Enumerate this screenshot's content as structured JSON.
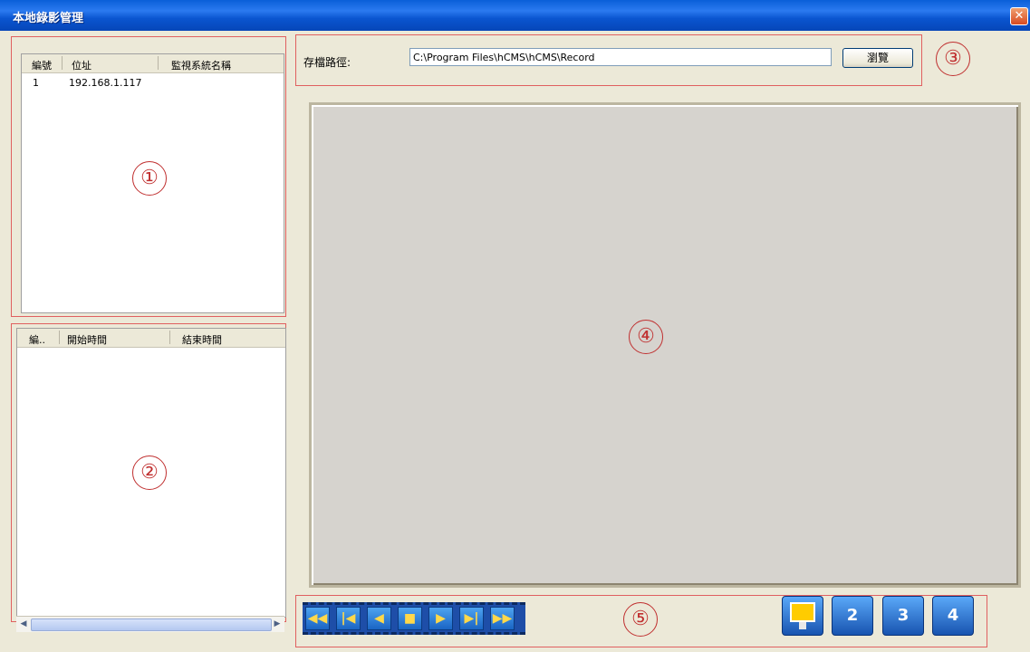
{
  "window": {
    "title": "本地錄影管理",
    "close_label": "✕"
  },
  "device_list": {
    "headers": [
      "編號",
      "位址",
      "監視系統名稱"
    ],
    "rows": [
      {
        "id": "1",
        "address": "192.168.1.117",
        "name": ""
      }
    ]
  },
  "record_list": {
    "headers": [
      "編..",
      "開始時間",
      "結束時間"
    ]
  },
  "path": {
    "label": "存檔路徑:",
    "value": "C:\\Program Files\\hCMS\\hCMS\\Record",
    "browse_label": "瀏覽"
  },
  "markers": [
    "①",
    "②",
    "③",
    "④",
    "⑤"
  ],
  "playback_controls": [
    {
      "icon": "fast-rewind-icon",
      "glyph": "◀◀"
    },
    {
      "icon": "skip-to-start-icon",
      "glyph": "|◀"
    },
    {
      "icon": "step-back-icon",
      "glyph": "◀"
    },
    {
      "icon": "stop-icon",
      "glyph": "■"
    },
    {
      "icon": "play-icon",
      "glyph": "▶"
    },
    {
      "icon": "skip-to-end-icon",
      "glyph": "▶|"
    },
    {
      "icon": "fast-forward-icon",
      "glyph": "▶▶"
    }
  ],
  "split_buttons": [
    {
      "icon": "single-monitor-icon",
      "label": ""
    },
    {
      "icon": "split-2-icon",
      "label": "2"
    },
    {
      "icon": "split-3-icon",
      "label": "3"
    },
    {
      "icon": "split-4-icon",
      "label": "4"
    }
  ],
  "colors": {
    "title_bar": "#0a55d0",
    "marker_red": "#c03030",
    "control_blue": "#1a64c4",
    "control_glyph": "#ffd84a"
  }
}
